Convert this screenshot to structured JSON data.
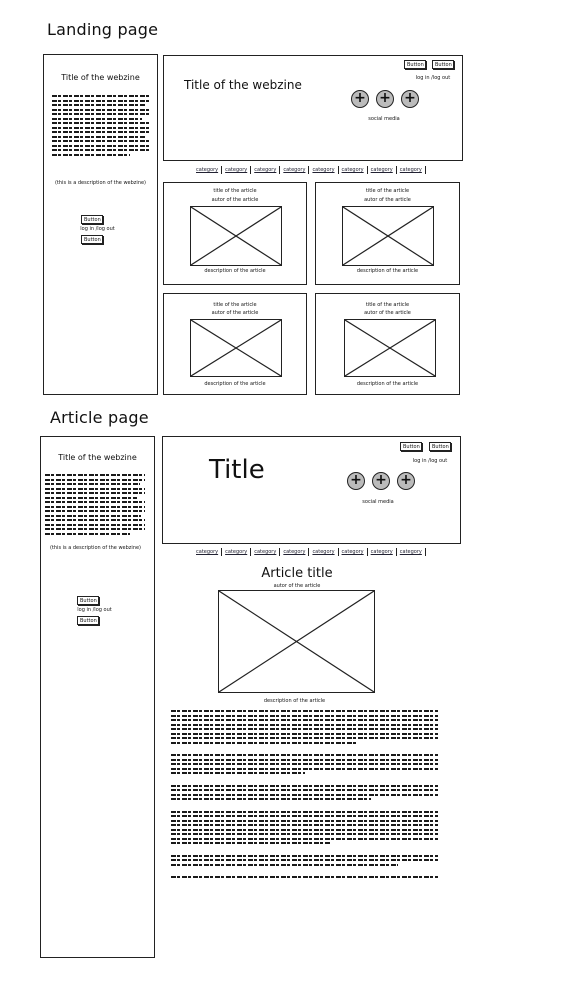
{
  "landing": {
    "heading": "Landing page",
    "sidebar": {
      "title": "Title of the webzine",
      "description": "(this is a description of the webzine)",
      "button_top": "Button",
      "login_text": "log in /log out",
      "button_bottom": "Button"
    },
    "header": {
      "title": "Title of the webzine",
      "button1": "Button",
      "button2": "Button",
      "login_text": "log in /log out",
      "social_label": "social media",
      "social_icons": [
        "plus-icon",
        "plus-icon",
        "plus-icon"
      ]
    },
    "categories": [
      "category",
      "category",
      "category",
      "category",
      "category",
      "category",
      "category",
      "category"
    ],
    "articles": [
      {
        "title": "title of the article",
        "author": "autor of the article",
        "description": "description of the article"
      },
      {
        "title": "title of the article",
        "author": "autor of the article",
        "description": "description of the article"
      },
      {
        "title": "title of the article",
        "author": "autor of the article",
        "description": "description of the article"
      },
      {
        "title": "title of the article",
        "author": "autor of the article",
        "description": "description of the article"
      }
    ]
  },
  "article_page": {
    "heading": "Article page",
    "sidebar": {
      "title": "Title of the webzine",
      "description": "(this is a description of the webzine)",
      "button_top": "Button",
      "login_text": "log in /log out",
      "button_bottom": "Button"
    },
    "header": {
      "title": "Title",
      "button1": "Button",
      "button2": "Button",
      "login_text": "log in /log out",
      "social_label": "social media",
      "social_icons": [
        "plus-icon",
        "plus-icon",
        "plus-icon"
      ]
    },
    "categories": [
      "category",
      "category",
      "category",
      "category",
      "category",
      "category",
      "category",
      "category"
    ],
    "article": {
      "title": "Article title",
      "author": "autor of the article",
      "image_description": "description of the article"
    }
  },
  "colors": {
    "line": "#222222",
    "social_button": "#bbbbbb",
    "background": "#ffffff"
  }
}
